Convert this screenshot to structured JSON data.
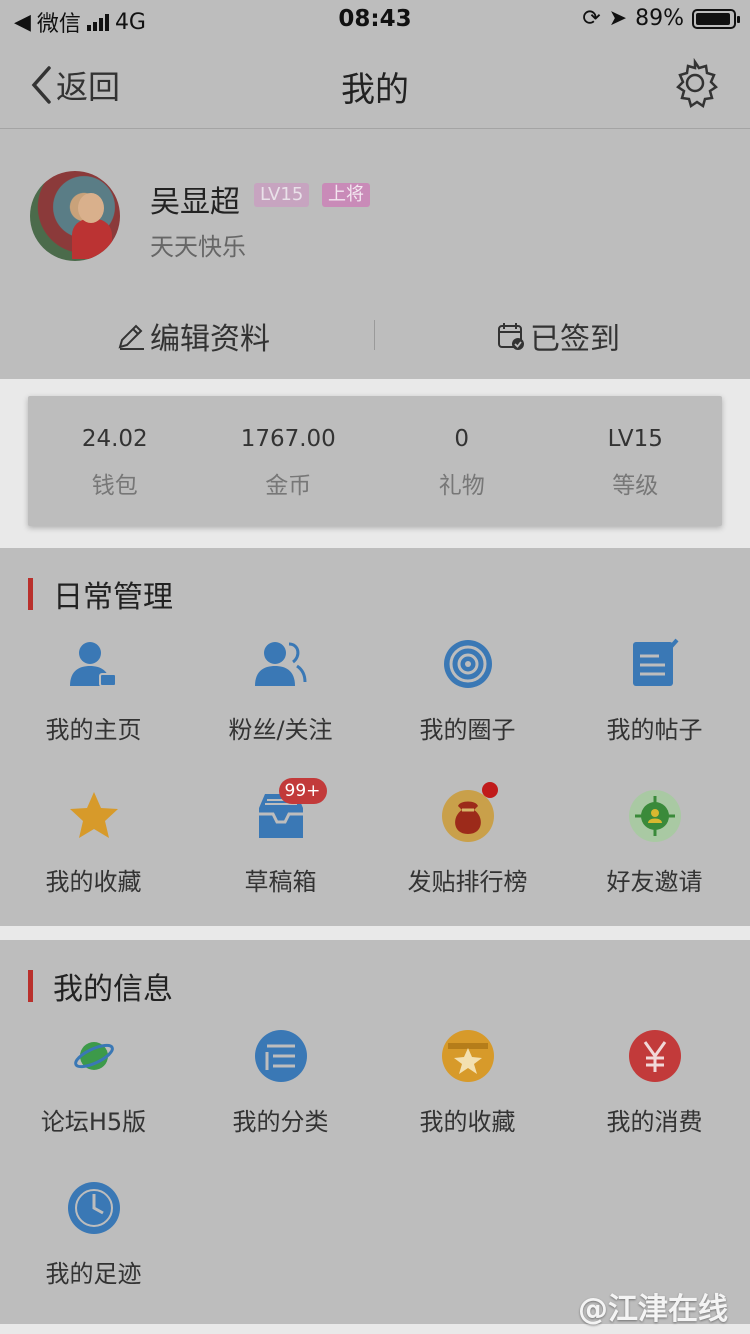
{
  "status_bar": {
    "back_app": "微信",
    "network": "4G",
    "time": "08:43",
    "battery": "89%"
  },
  "nav": {
    "back_label": "返回",
    "title": "我的"
  },
  "profile": {
    "name": "吴显超",
    "level_badge": "LV15",
    "rank_badge": "上将",
    "signature": "天天快乐",
    "edit_label": "编辑资料",
    "signin_label": "已签到"
  },
  "stats": [
    {
      "value": "24.02",
      "label": "钱包"
    },
    {
      "value": "1767.00",
      "label": "金币"
    },
    {
      "value": "0",
      "label": "礼物"
    },
    {
      "value": "LV15",
      "label": "等级"
    }
  ],
  "daily": {
    "title": "日常管理",
    "items": [
      {
        "label": "我的主页",
        "icon": "user-home-icon"
      },
      {
        "label": "粉丝/关注",
        "icon": "fans-icon"
      },
      {
        "label": "我的圈子",
        "icon": "circle-target-icon"
      },
      {
        "label": "我的帖子",
        "icon": "post-edit-icon"
      },
      {
        "label": "我的收藏",
        "icon": "star-icon"
      },
      {
        "label": "草稿箱",
        "icon": "drafts-inbox-icon",
        "badge": "99+"
      },
      {
        "label": "发贴排行榜",
        "icon": "money-bag-icon"
      },
      {
        "label": "好友邀请",
        "icon": "invite-friend-icon"
      }
    ]
  },
  "info": {
    "title": "我的信息",
    "items": [
      {
        "label": "论坛H5版",
        "icon": "planet-icon"
      },
      {
        "label": "我的分类",
        "icon": "category-list-icon"
      },
      {
        "label": "我的收藏",
        "icon": "favorite-box-icon"
      },
      {
        "label": "我的消费",
        "icon": "yuan-icon"
      },
      {
        "label": "我的足迹",
        "icon": "clock-icon"
      }
    ]
  },
  "watermark": "@江津在线",
  "colors": {
    "accent_bar": "#b9302c",
    "badge_red": "#c23a3a",
    "icon_blue": "#3a78b5",
    "icon_gold": "#d79a2a"
  }
}
